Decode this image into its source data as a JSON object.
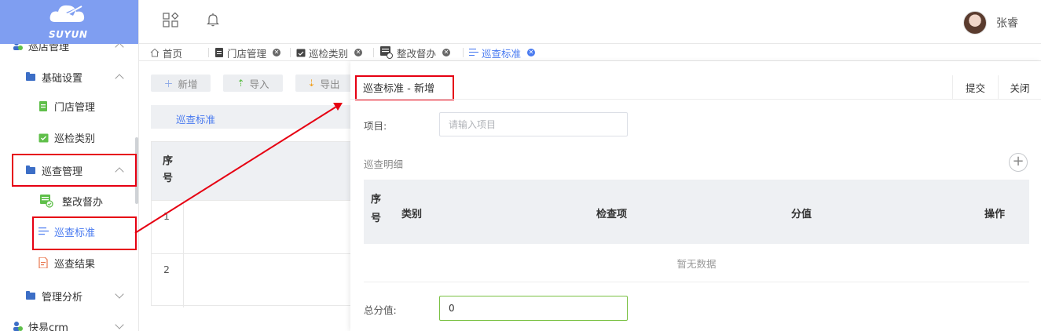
{
  "brand": {
    "logo_text": "SUYUN"
  },
  "sidebar": {
    "items": [
      {
        "label": "巡店管理"
      },
      {
        "label": "基础设置"
      },
      {
        "label": "门店管理"
      },
      {
        "label": "巡检类别"
      },
      {
        "label": "巡查管理"
      },
      {
        "label": "整改督办"
      },
      {
        "label": "巡查标准"
      },
      {
        "label": "巡查结果"
      },
      {
        "label": "管理分析"
      },
      {
        "label": "快易crm"
      }
    ]
  },
  "header": {
    "username": "张睿"
  },
  "tabs": [
    {
      "label": "首页"
    },
    {
      "label": "门店管理"
    },
    {
      "label": "巡检类别"
    },
    {
      "label": "整改督办"
    },
    {
      "label": "巡查标准"
    }
  ],
  "list_page": {
    "toolbar": {
      "add": "新增",
      "import": "导入",
      "export": "导出"
    },
    "breadcrumb": "巡查标准",
    "table": {
      "seq_header": "序号",
      "rows": [
        "1",
        "2"
      ]
    }
  },
  "panel": {
    "title": "巡查标准 - 新增",
    "submit": "提交",
    "close": "关闭",
    "project_label": "项目:",
    "project_placeholder": "请输入项目",
    "detail_label": "巡查明细",
    "table": {
      "headers": {
        "seq": "序号",
        "category": "类别",
        "check_item": "检查项",
        "score": "分值",
        "action": "操作"
      },
      "empty_text": "暂无数据"
    },
    "total_label": "总分值:",
    "total_value": "0"
  },
  "colors": {
    "accent": "#4a7bf0",
    "logo_bg": "#7f9ef1",
    "annotation": "#e60012",
    "input_ok": "#7ac143"
  }
}
